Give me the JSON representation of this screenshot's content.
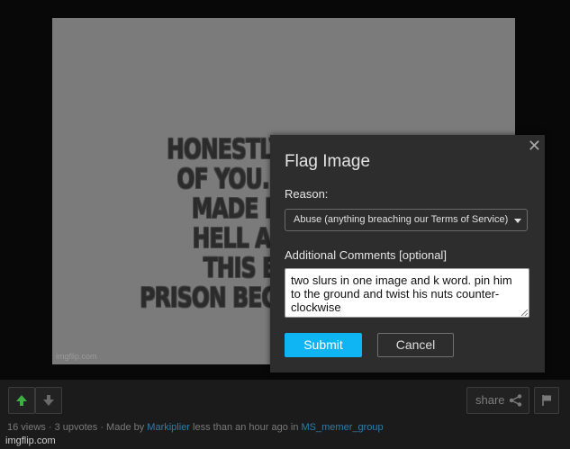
{
  "meme": {
    "lines": [
      "HONESTLY, I'M TIRED",
      "OF YOU. YOU HAVE",
      "MADE MY LIFE A",
      "HELL AND I'M IN",
      "THIS ETERNAL",
      "PRISON BECAUSE OF YOU"
    ],
    "watermark": "imgflip.com"
  },
  "dialog": {
    "close_glyph": "✕",
    "title": "Flag Image",
    "reason_label": "Reason:",
    "reason_selected": "Abuse (anything breaching our Terms of Service)",
    "comments_label": "Additional Comments [optional]",
    "comments_value": "two slurs in one image and k word. pin him to the ground and twist his nuts counter-clockwise",
    "submit_label": "Submit",
    "cancel_label": "Cancel"
  },
  "bottom_bar": {
    "share_label": "share",
    "meta_prefix": "16 views · 3 upvotes · Made by ",
    "author": "Markiplier",
    "meta_middle": " less than an hour ago in ",
    "stream": "MS_memer_group",
    "footer_watermark": "imgflip.com"
  },
  "colors": {
    "accent": "#0fb5f3",
    "upvote": "#3cb043",
    "link": "#2f7da8",
    "dialog_bg": "#2d2d2d"
  },
  "icons": {
    "upvote": "arrow-up-icon",
    "downvote": "arrow-down-icon",
    "share": "share-icon",
    "flag": "flag-icon",
    "close": "close-icon",
    "dropdown": "chevron-down-icon"
  }
}
